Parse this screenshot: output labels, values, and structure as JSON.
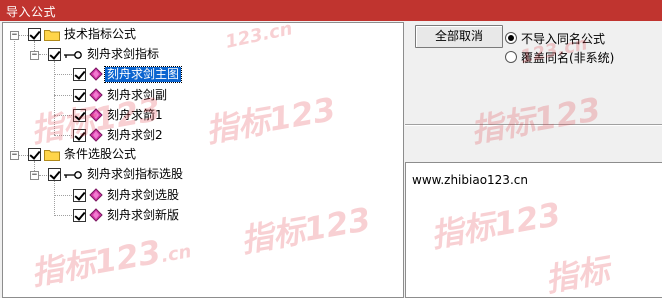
{
  "window": {
    "title": "导入公式"
  },
  "tree": {
    "nodes": [
      {
        "label": "技术指标公式",
        "icon": "folder-icon",
        "checked": true
      },
      {
        "label": "刻舟求剑指标",
        "icon": "key-icon",
        "checked": true
      },
      {
        "label": "刻舟求剑主图",
        "icon": "formula-gem-icon",
        "checked": true,
        "selected": true
      },
      {
        "label": "刻舟求剑副",
        "icon": "formula-gem-icon",
        "checked": true
      },
      {
        "label": "刻舟求箭1",
        "icon": "formula-gem-icon",
        "checked": true
      },
      {
        "label": "刻舟求剑2",
        "icon": "formula-gem-icon",
        "checked": true
      },
      {
        "label": "条件选股公式",
        "icon": "folder-icon",
        "checked": true
      },
      {
        "label": "刻舟求剑指标选股",
        "icon": "key-icon",
        "checked": true
      },
      {
        "label": "刻舟求剑选股",
        "icon": "formula-gem-icon",
        "checked": true
      },
      {
        "label": "刻舟求剑新版",
        "icon": "formula-gem-icon",
        "checked": true
      }
    ]
  },
  "actions": {
    "cancel_all_label": "全部取消"
  },
  "options": {
    "selected": "不导入同名公式",
    "items": [
      "不导入同名公式",
      "覆盖同名(非系统)"
    ]
  },
  "info": {
    "url": "www.zhibiao123.cn"
  },
  "watermark": {
    "text": "指标123",
    "suffix": ".cn"
  },
  "colors": {
    "titlebar": "#c0342f",
    "selection": "#0a64d0",
    "watermark": "#e0303a"
  }
}
